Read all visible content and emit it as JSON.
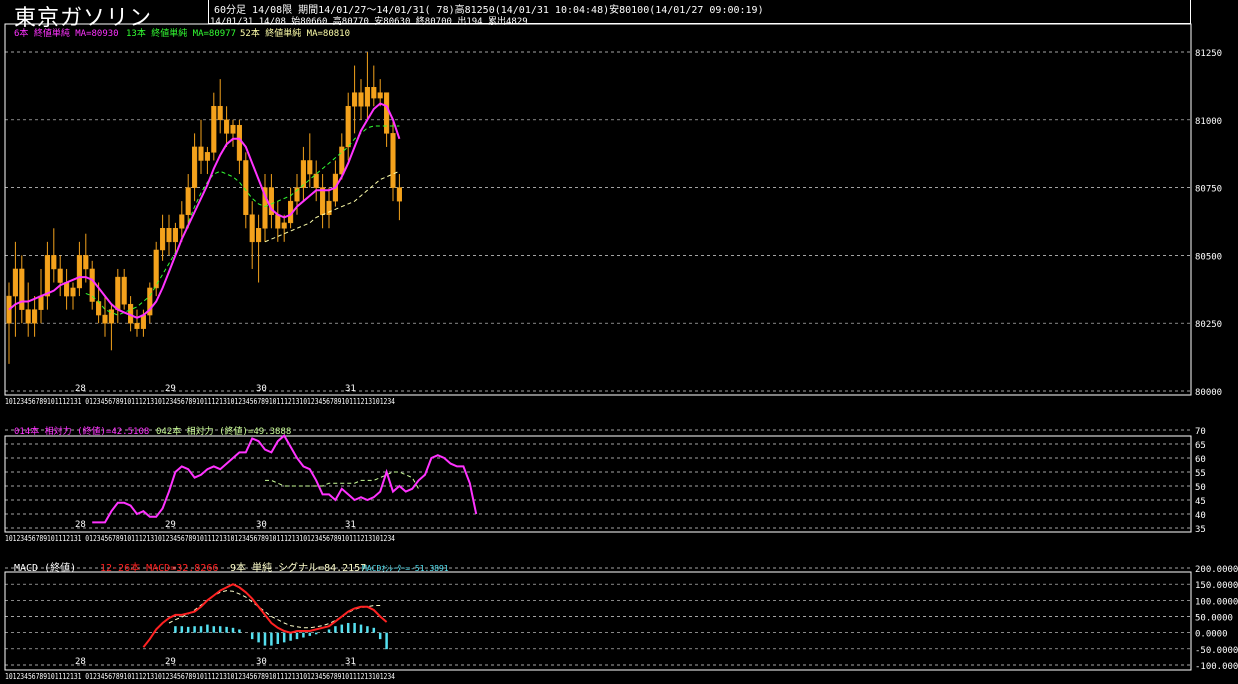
{
  "title": "東京ガソリン",
  "header": {
    "line1": "60分足 14/08限  期間14/01/27〜14/01/31( 78)高81250(14/01/31 10:04:48)安80100(14/01/27 09:00:19)",
    "line2": "14/01/31 14/08 始80660 高80770 安80630 終80700 出194 累出4829"
  },
  "colors": {
    "background": "#000000",
    "candle": "#f4a21c",
    "ma6": "#ff33ff",
    "ma13": "#33ff33",
    "ma52": "#ffffaa",
    "rsi14": "#ff33ff",
    "rsi42": "#ccff99",
    "macd": "#ff2222",
    "signal": "#ffffcc",
    "osc": "#55e0f0",
    "grid": "#ffffff"
  },
  "price_legend": {
    "ma6": "6本 終値単純 MA=80930",
    "ma13": "13本 終値単純 MA=80977",
    "ma52": "52本 終値単純 MA=80810"
  },
  "rsi_legend": {
    "r14": "014本 相対力 (終値)=42.5108",
    "r42": "042本 相対力 (終値)=49.3888"
  },
  "macd_legend": {
    "name": "MACD (終値)",
    "macd": "12-26本 MACD=32.8266",
    "signal": "9本 単純 シグナル=84.2157",
    "osc": "MACDｵｼﾚｰﾀｰ=-51.3891"
  },
  "chart_data": [
    {
      "type": "candlestick",
      "title": "",
      "ylim": [
        80000,
        81250
      ],
      "y_ticks": [
        "81250",
        "81000",
        "80750",
        "80500",
        "80250",
        "80000"
      ],
      "day_labels": [
        "28",
        "29",
        "30",
        "31"
      ],
      "x_hour_label": "10123456789101112131 012345678910111213101234567891011121310123456789101112131012345678910111213101234",
      "candles": [
        {
          "o": 80250,
          "h": 80400,
          "l": 80100,
          "c": 80350
        },
        {
          "o": 80350,
          "h": 80550,
          "l": 80200,
          "c": 80450
        },
        {
          "o": 80450,
          "h": 80500,
          "l": 80250,
          "c": 80300
        },
        {
          "o": 80300,
          "h": 80400,
          "l": 80200,
          "c": 80250
        },
        {
          "o": 80250,
          "h": 80350,
          "l": 80200,
          "c": 80300
        },
        {
          "o": 80300,
          "h": 80450,
          "l": 80250,
          "c": 80350
        },
        {
          "o": 80350,
          "h": 80550,
          "l": 80300,
          "c": 80500
        },
        {
          "o": 80500,
          "h": 80600,
          "l": 80400,
          "c": 80450
        },
        {
          "o": 80450,
          "h": 80500,
          "l": 80350,
          "c": 80400
        },
        {
          "o": 80400,
          "h": 80450,
          "l": 80300,
          "c": 80350
        },
        {
          "o": 80350,
          "h": 80400,
          "l": 80300,
          "c": 80380
        },
        {
          "o": 80380,
          "h": 80550,
          "l": 80350,
          "c": 80500
        },
        {
          "o": 80500,
          "h": 80580,
          "l": 80400,
          "c": 80450
        },
        {
          "o": 80450,
          "h": 80480,
          "l": 80300,
          "c": 80330
        },
        {
          "o": 80330,
          "h": 80400,
          "l": 80250,
          "c": 80280
        },
        {
          "o": 80280,
          "h": 80350,
          "l": 80200,
          "c": 80250
        },
        {
          "o": 80250,
          "h": 80320,
          "l": 80150,
          "c": 80300
        },
        {
          "o": 80300,
          "h": 80450,
          "l": 80250,
          "c": 80420
        },
        {
          "o": 80420,
          "h": 80450,
          "l": 80300,
          "c": 80320
        },
        {
          "o": 80320,
          "h": 80350,
          "l": 80220,
          "c": 80250
        },
        {
          "o": 80250,
          "h": 80300,
          "l": 80200,
          "c": 80230
        },
        {
          "o": 80230,
          "h": 80300,
          "l": 80200,
          "c": 80280
        },
        {
          "o": 80280,
          "h": 80400,
          "l": 80250,
          "c": 80380
        },
        {
          "o": 80380,
          "h": 80550,
          "l": 80350,
          "c": 80520
        },
        {
          "o": 80520,
          "h": 80650,
          "l": 80480,
          "c": 80600
        },
        {
          "o": 80600,
          "h": 80650,
          "l": 80500,
          "c": 80550
        },
        {
          "o": 80550,
          "h": 80620,
          "l": 80500,
          "c": 80600
        },
        {
          "o": 80600,
          "h": 80700,
          "l": 80550,
          "c": 80650
        },
        {
          "o": 80650,
          "h": 80800,
          "l": 80600,
          "c": 80750
        },
        {
          "o": 80750,
          "h": 80950,
          "l": 80700,
          "c": 80900
        },
        {
          "o": 80900,
          "h": 81000,
          "l": 80800,
          "c": 80850
        },
        {
          "o": 80850,
          "h": 80900,
          "l": 80800,
          "c": 80880
        },
        {
          "o": 80880,
          "h": 81100,
          "l": 80850,
          "c": 81050
        },
        {
          "o": 81050,
          "h": 81150,
          "l": 80950,
          "c": 81000
        },
        {
          "o": 81000,
          "h": 81050,
          "l": 80900,
          "c": 80950
        },
        {
          "o": 80950,
          "h": 81000,
          "l": 80900,
          "c": 80980
        },
        {
          "o": 80980,
          "h": 81000,
          "l": 80800,
          "c": 80850
        },
        {
          "o": 80850,
          "h": 80880,
          "l": 80600,
          "c": 80650
        },
        {
          "o": 80650,
          "h": 80700,
          "l": 80450,
          "c": 80550
        },
        {
          "o": 80550,
          "h": 80650,
          "l": 80400,
          "c": 80600
        },
        {
          "o": 80600,
          "h": 80800,
          "l": 80550,
          "c": 80750
        },
        {
          "o": 80750,
          "h": 80800,
          "l": 80600,
          "c": 80650
        },
        {
          "o": 80650,
          "h": 80700,
          "l": 80550,
          "c": 80600
        },
        {
          "o": 80600,
          "h": 80650,
          "l": 80550,
          "c": 80620
        },
        {
          "o": 80620,
          "h": 80750,
          "l": 80600,
          "c": 80700
        },
        {
          "o": 80700,
          "h": 80800,
          "l": 80650,
          "c": 80750
        },
        {
          "o": 80750,
          "h": 80900,
          "l": 80700,
          "c": 80850
        },
        {
          "o": 80850,
          "h": 80950,
          "l": 80750,
          "c": 80800
        },
        {
          "o": 80800,
          "h": 80850,
          "l": 80700,
          "c": 80750
        },
        {
          "o": 80750,
          "h": 80800,
          "l": 80600,
          "c": 80650
        },
        {
          "o": 80650,
          "h": 80750,
          "l": 80600,
          "c": 80700
        },
        {
          "o": 80700,
          "h": 80850,
          "l": 80680,
          "c": 80800
        },
        {
          "o": 80800,
          "h": 80950,
          "l": 80780,
          "c": 80900
        },
        {
          "o": 80900,
          "h": 81100,
          "l": 80850,
          "c": 81050
        },
        {
          "o": 81050,
          "h": 81200,
          "l": 80950,
          "c": 81100
        },
        {
          "o": 81100,
          "h": 81150,
          "l": 81000,
          "c": 81050
        },
        {
          "o": 81050,
          "h": 81250,
          "l": 81000,
          "c": 81120
        },
        {
          "o": 81120,
          "h": 81200,
          "l": 81050,
          "c": 81080
        },
        {
          "o": 81080,
          "h": 81150,
          "l": 81050,
          "c": 81100
        },
        {
          "o": 81100,
          "h": 81100,
          "l": 80900,
          "c": 80950
        },
        {
          "o": 80950,
          "h": 81000,
          "l": 80700,
          "c": 80750
        },
        {
          "o": 80750,
          "h": 80800,
          "l": 80630,
          "c": 80700
        }
      ],
      "ma6": [
        80300,
        80320,
        80330,
        80330,
        80340,
        80350,
        80360,
        80370,
        80390,
        80400,
        80410,
        80420,
        80420,
        80410,
        80380,
        80350,
        80320,
        80300,
        80290,
        80280,
        80270,
        80280,
        80300,
        80330,
        80380,
        80440,
        80500,
        80560,
        80610,
        80660,
        80710,
        80760,
        80820,
        80870,
        80910,
        80930,
        80930,
        80900,
        80840,
        80780,
        80720,
        80670,
        80650,
        80640,
        80650,
        80680,
        80700,
        80720,
        80740,
        80740,
        80740,
        80750,
        80790,
        80840,
        80900,
        80960,
        81000,
        81040,
        81060,
        81050,
        81000,
        80930
      ],
      "ma13": [
        null,
        null,
        null,
        null,
        null,
        null,
        null,
        null,
        null,
        null,
        null,
        null,
        80360,
        80350,
        80330,
        80300,
        80290,
        80280,
        80290,
        80300,
        80310,
        80330,
        80350,
        80390,
        80430,
        80470,
        80510,
        80560,
        80620,
        80680,
        80730,
        80770,
        80800,
        80810,
        80800,
        80790,
        80770,
        80740,
        80710,
        80690,
        80680,
        80690,
        80700,
        80710,
        80720,
        80740,
        80760,
        80780,
        80800,
        80820,
        80840,
        80860,
        80880,
        80900,
        80930,
        80950,
        80970,
        80977,
        80977,
        80977,
        80977,
        80977
      ],
      "ma52": [
        null,
        null,
        null,
        null,
        null,
        null,
        null,
        null,
        null,
        null,
        null,
        null,
        null,
        null,
        null,
        null,
        null,
        null,
        null,
        null,
        null,
        null,
        null,
        null,
        null,
        null,
        null,
        null,
        null,
        null,
        null,
        null,
        null,
        null,
        null,
        null,
        null,
        null,
        null,
        null,
        80550,
        80560,
        80570,
        80580,
        80590,
        80600,
        80610,
        80620,
        80640,
        80650,
        80660,
        80670,
        80680,
        80690,
        80700,
        80720,
        80740,
        80760,
        80780,
        80790,
        80800,
        80810
      ]
    },
    {
      "type": "line",
      "title": "",
      "ylim": [
        35,
        70
      ],
      "y_ticks": [
        "70",
        "65",
        "60",
        "55",
        "50",
        "45",
        "40",
        "35"
      ],
      "day_labels": [
        "28",
        "29",
        "30",
        "31"
      ],
      "series": [
        {
          "name": "014本 相対力",
          "start": 13,
          "values": [
            37,
            37,
            37,
            41,
            44,
            44,
            43,
            40,
            41,
            39,
            39,
            42,
            48,
            55,
            57,
            56,
            53,
            54,
            56,
            57,
            56,
            58,
            60,
            62,
            62,
            67,
            66,
            63,
            62,
            66,
            68,
            64,
            60,
            57,
            56,
            52,
            47,
            47,
            45,
            49,
            47,
            45,
            46,
            45,
            46,
            48,
            55,
            48,
            50,
            48,
            49,
            52,
            54,
            60,
            61,
            60,
            58,
            57,
            57,
            51,
            40
          ]
        },
        {
          "name": "042本 相対力",
          "start": 40,
          "values": [
            52,
            52,
            51,
            50,
            50,
            50,
            50,
            50,
            50,
            50,
            51,
            51,
            51,
            51,
            51,
            52,
            52,
            52,
            53,
            54,
            55,
            55,
            54,
            53,
            49
          ]
        }
      ]
    },
    {
      "type": "line",
      "title": "",
      "ylim": [
        -100,
        200
      ],
      "y_ticks": [
        "200.0000",
        "150.0000",
        "100.0000",
        "50.0000",
        "0.0000",
        "-50.0000",
        "-100.0000"
      ],
      "day_labels": [
        "28",
        "29",
        "30",
        "31"
      ],
      "series": [
        {
          "name": "MACD",
          "start": 21,
          "values": [
            -45,
            -20,
            10,
            30,
            45,
            55,
            55,
            60,
            65,
            80,
            100,
            115,
            130,
            140,
            150,
            140,
            125,
            105,
            80,
            55,
            30,
            15,
            5,
            0,
            5,
            5,
            5,
            10,
            15,
            20,
            35,
            50,
            65,
            75,
            80,
            80,
            70,
            50,
            33
          ]
        },
        {
          "name": "シグナル",
          "start": 25,
          "values": [
            30,
            40,
            48,
            58,
            70,
            85,
            100,
            115,
            125,
            130,
            128,
            120,
            110,
            95,
            80,
            65,
            50,
            40,
            30,
            22,
            18,
            15,
            15,
            18,
            22,
            28,
            38,
            50,
            62,
            72,
            78,
            80,
            84,
            84
          ]
        },
        {
          "name": "MACDｵｼﾚｰﾀｰ",
          "start": 26,
          "values": [
            20,
            20,
            18,
            20,
            20,
            25,
            20,
            20,
            18,
            15,
            10,
            0,
            -20,
            -30,
            -40,
            -40,
            -35,
            -30,
            -25,
            -20,
            -15,
            -10,
            -5,
            0,
            10,
            20,
            25,
            30,
            30,
            25,
            20,
            15,
            -20,
            -51
          ]
        }
      ]
    }
  ]
}
